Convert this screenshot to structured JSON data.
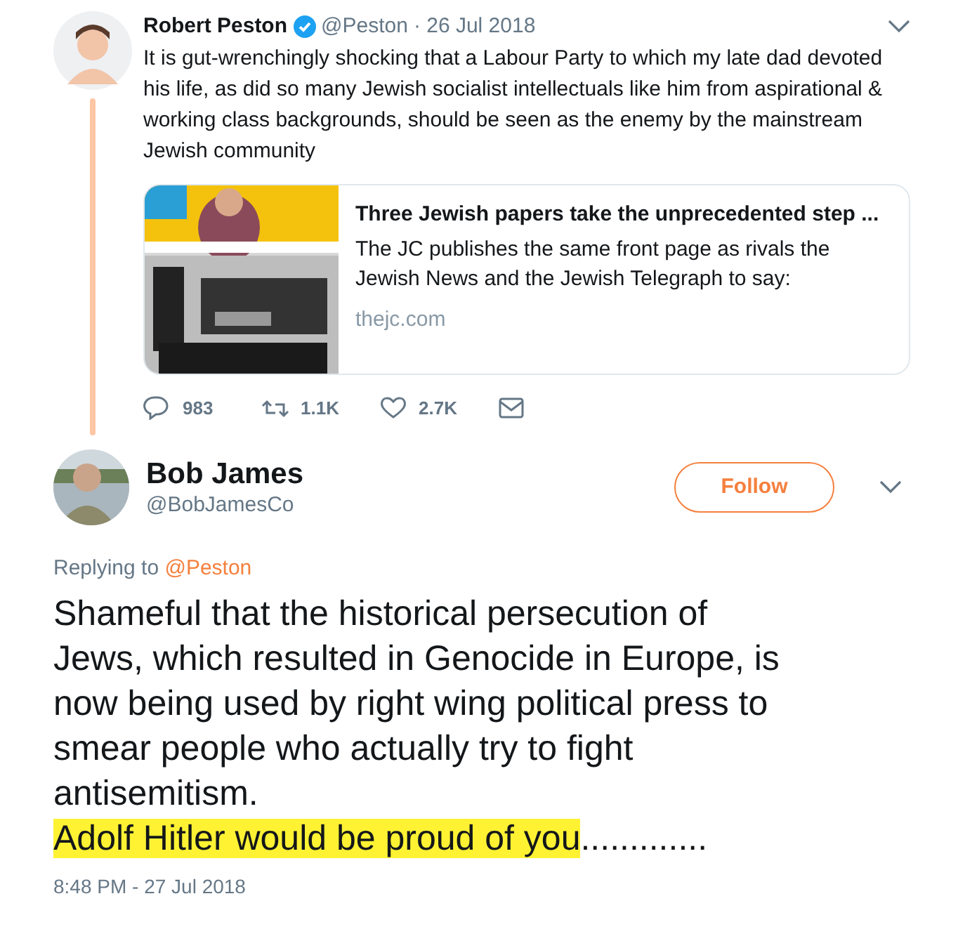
{
  "parent_tweet": {
    "name": "Robert Peston",
    "verified": true,
    "handle": "@Peston",
    "date": "· 26 Jul 2018",
    "text": "It is gut-wrenchingly shocking that a Labour Party to which my late dad devoted his life, as did so many Jewish socialist intellectuals like him from aspirational & working class backgrounds, should be seen as the enemy by the mainstream Jewish community",
    "card": {
      "title": "Three Jewish papers take the unprecedented step ...",
      "description": "The JC publishes the same front page as rivals the Jewish News and the Jewish Telegraph to say:",
      "domain": "thejc.com"
    },
    "actions": [
      {
        "kind": "reply",
        "count": "983"
      },
      {
        "kind": "retweet",
        "count": "1.1K"
      },
      {
        "kind": "like",
        "count": "2.7K"
      },
      {
        "kind": "message"
      }
    ]
  },
  "reply_tweet": {
    "name": "Bob James",
    "handle": "@BobJamesCo",
    "follow_button": "Follow",
    "replying_label": "Replying to",
    "replying_to": "@Peston",
    "paragraphs": [
      [
        {
          "text": "Shameful that the historical persecution of Jews, which resulted in Genocide in Europe, is now being used by right wing political press to smear people who actually try to fight antisemitism.",
          "highlighted": false
        }
      ],
      [
        {
          "text": "Adolf Hitler would be proud of you",
          "highlighted": true
        },
        {
          "text": ".............",
          "highlighted": false
        }
      ]
    ],
    "timestamp": "8:48 PM - 27 Jul 2018"
  }
}
